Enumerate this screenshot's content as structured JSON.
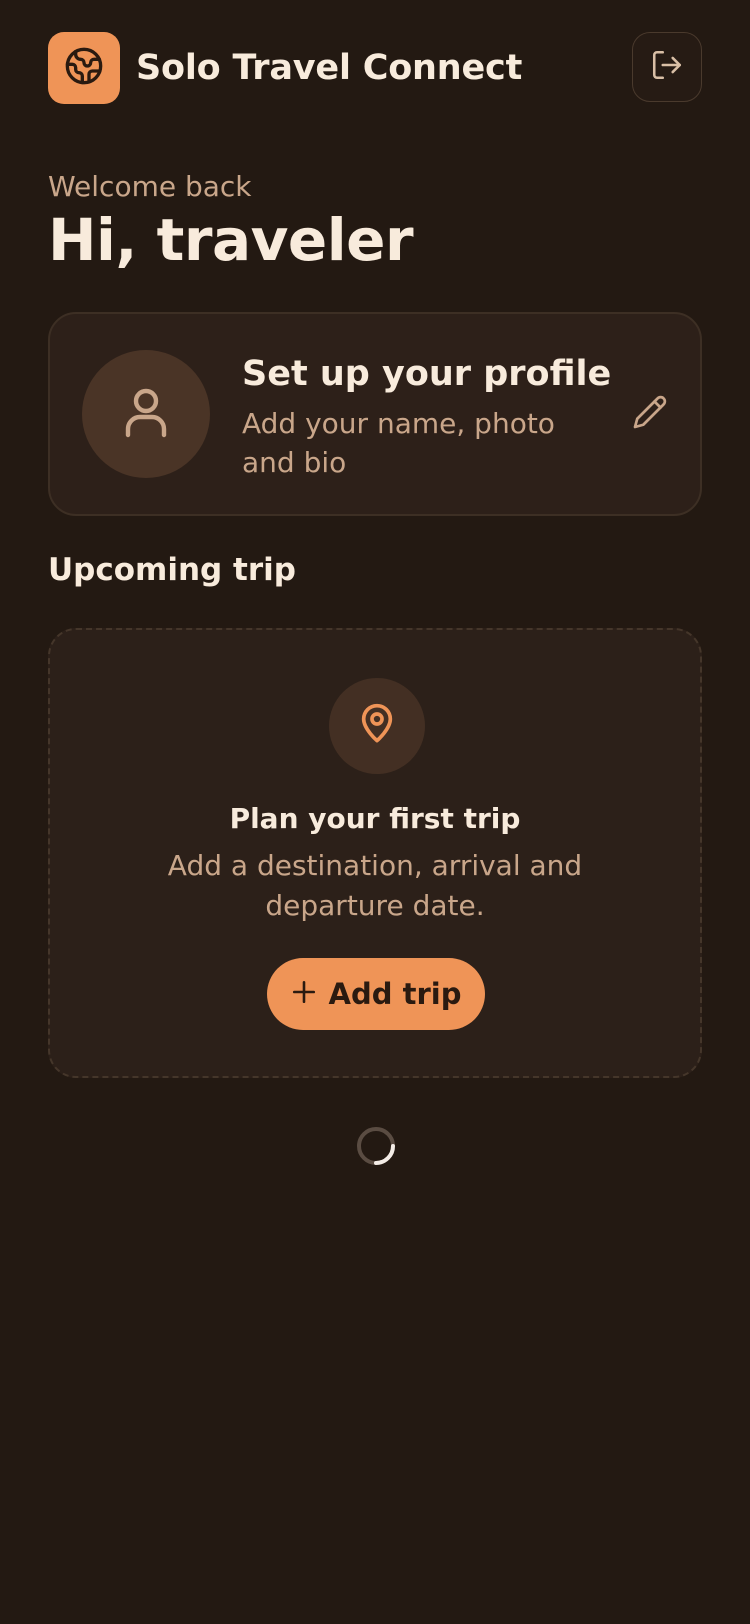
{
  "header": {
    "app_title": "Solo Travel Connect",
    "logo_icon": "globe-icon",
    "logout_icon": "logout-icon"
  },
  "welcome": {
    "subtitle": "Welcome back",
    "greeting": "Hi, traveler"
  },
  "profile_card": {
    "title": "Set up your profile",
    "subtitle": "Add your name, photo and bio",
    "avatar_icon": "user-icon",
    "edit_icon": "pencil-icon"
  },
  "upcoming_trip": {
    "section_title": "Upcoming trip",
    "empty_title": "Plan your first trip",
    "empty_subtitle": "Add a destination, arrival and departure date.",
    "pin_icon": "map-pin-icon",
    "add_button_label": "Add trip",
    "add_button_icon": "plus-icon"
  },
  "status": {
    "loading_indicator": "spinner-icon"
  },
  "colors": {
    "background": "#231912",
    "accent": "#ef9457",
    "card": "#2d2019",
    "text_primary": "#f8ebdc",
    "text_secondary": "#c9a68a"
  }
}
